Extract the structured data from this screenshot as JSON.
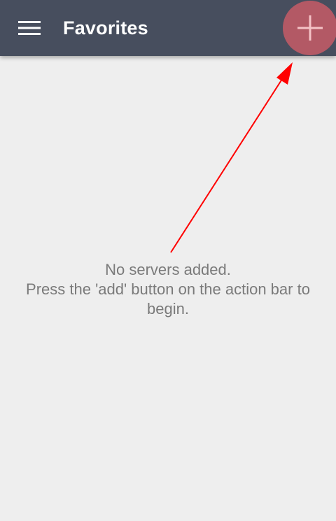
{
  "action_bar": {
    "title": "Favorites",
    "menu_icon": "hamburger-menu-icon",
    "add_icon": "plus-icon"
  },
  "empty_state": {
    "line1": "No servers added.",
    "line2": "Press the 'add' button on the action bar to",
    "line3": "begin."
  },
  "annotation": {
    "arrow_color": "#ff0000"
  },
  "colors": {
    "action_bar_bg": "#474e5e",
    "background": "#eeeeee",
    "add_button_highlight": "#c75c66",
    "text": "#7a7a7a"
  }
}
